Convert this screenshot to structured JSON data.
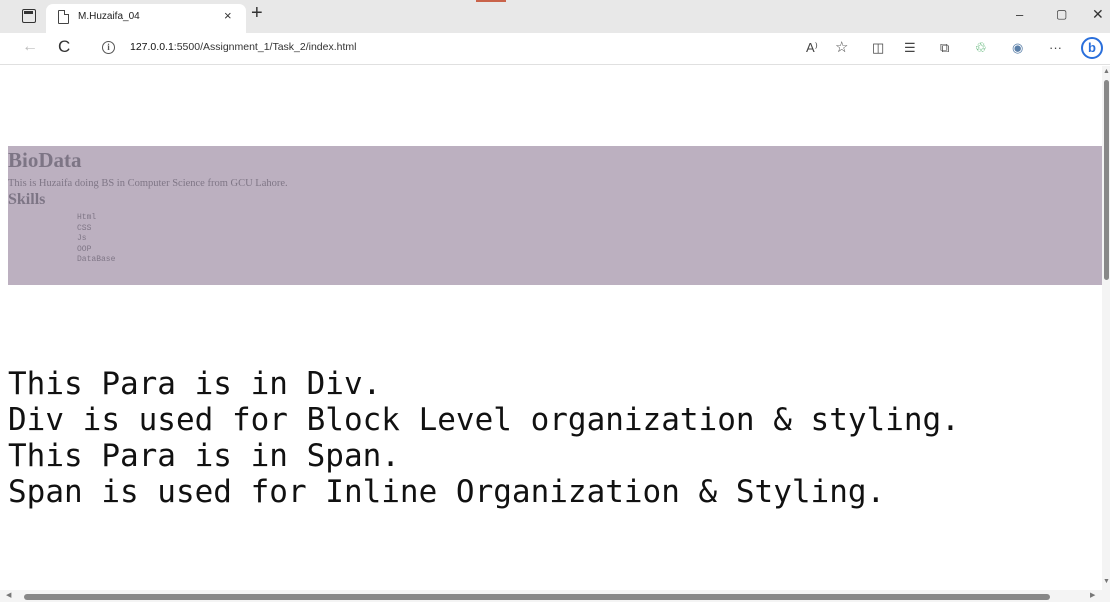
{
  "browser": {
    "tab_title": "M.Huzaifa_04",
    "tab_close": "×",
    "new_tab": "+",
    "url_host": "127.0.0.1",
    "url_rest": ":5500/Assignment_1/Task_2/index.html",
    "window_min": "–",
    "window_max": "▢",
    "window_close": "✕",
    "icons": {
      "back": "←",
      "reload": "C",
      "info": "i",
      "read_aloud": "A⁾",
      "favorite": "☆",
      "split": "◫",
      "favorites_bar": "☰",
      "collections": "⧉",
      "extensions": "♲",
      "profile": "◉",
      "more": "···",
      "bing": "b"
    }
  },
  "page": {
    "biodata": {
      "title": "BioData",
      "description": "This is Huzaifa doing BS in Computer Science from GCU Lahore.",
      "skills_title": "Skills",
      "skills": [
        "Html",
        "CSS",
        "Js",
        "OOP",
        "DataBase"
      ]
    },
    "paragraphs": {
      "div_line1": "This Para is in Div.",
      "div_line2": "Div is used for Block Level organization & styling.",
      "span_line1": "This Para is in Span.",
      "span_line2": "Span is used for Inline Organization & Styling."
    }
  }
}
